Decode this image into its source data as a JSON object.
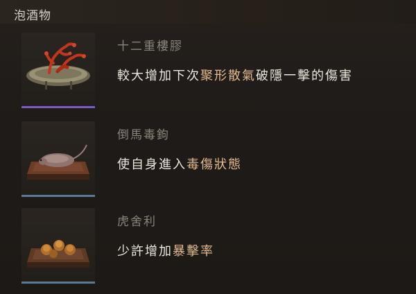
{
  "header": {
    "title": "泡酒物"
  },
  "colors": {
    "highlight": "#e2b98e",
    "text_main": "#ece7de",
    "text_name": "#8a847b",
    "rarity_purple": "#7b5bc2",
    "rarity_blue": "#5a7a96"
  },
  "items": [
    {
      "name": "十二重樓膠",
      "desc_pre": "較大增加下次",
      "desc_highlight": "聚形散氣",
      "desc_post": "破隱一擊的傷害",
      "icon": "red-coral-plate-icon",
      "rarity": "purple"
    },
    {
      "name": "倒馬毒鉤",
      "desc_pre": "使自身進入",
      "desc_highlight": "毒傷狀態",
      "desc_post": "",
      "icon": "rat-on-tray-icon",
      "rarity": "blue"
    },
    {
      "name": "虎舍利",
      "desc_pre": "少許增加",
      "desc_highlight": "暴擊率",
      "desc_post": "",
      "icon": "spheres-on-tray-icon",
      "rarity": "blue"
    }
  ]
}
